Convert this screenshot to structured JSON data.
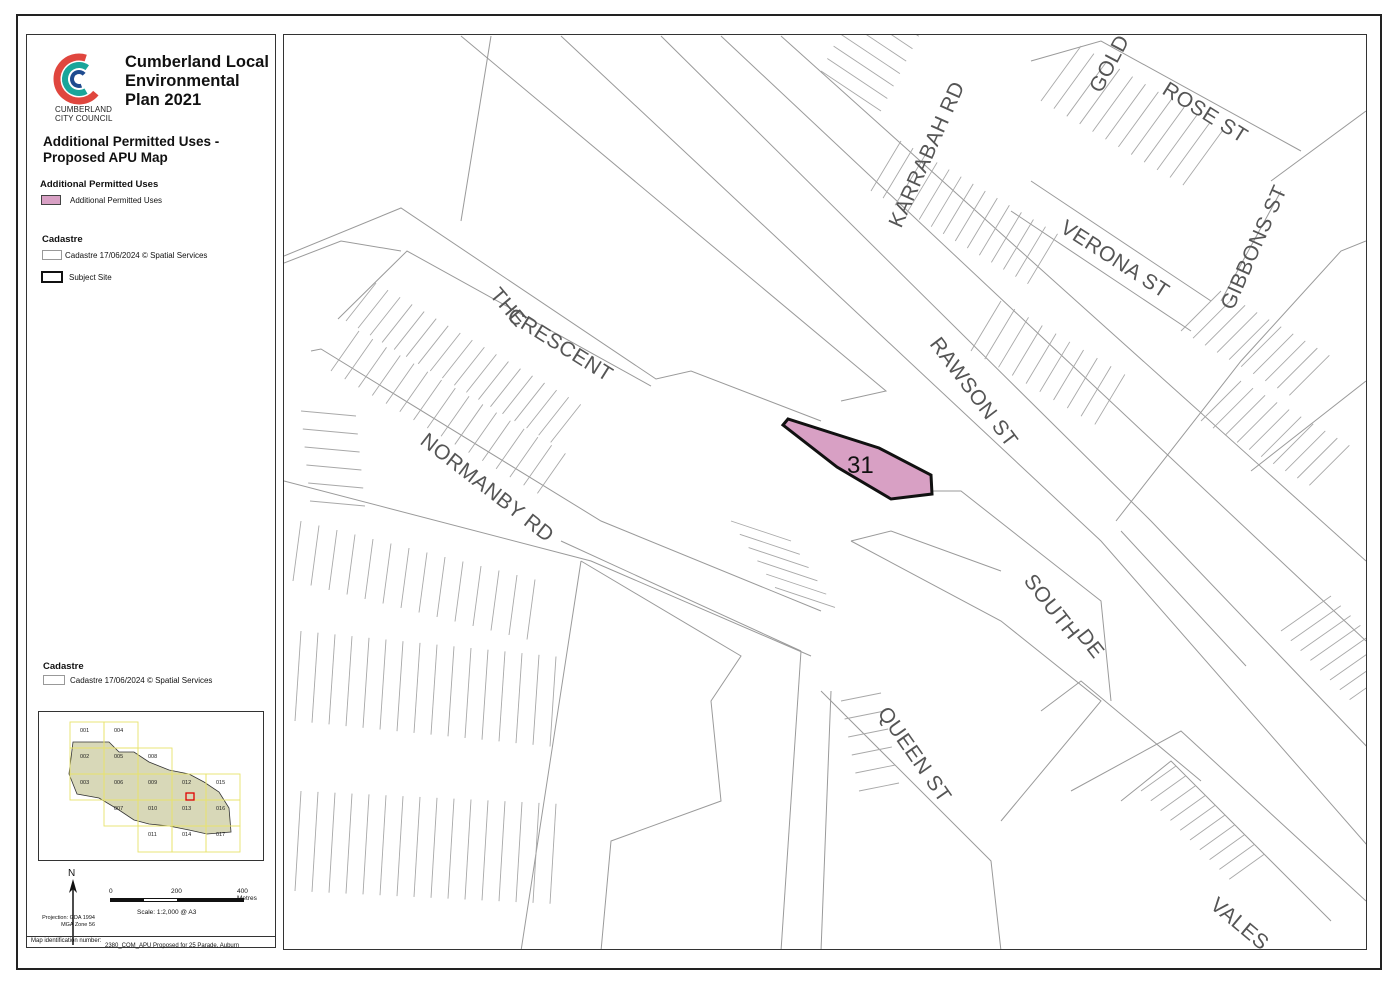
{
  "legend": {
    "council_logo_text": [
      "CUMBERLAND",
      "CITY COUNCIL"
    ],
    "plan_title": [
      "Cumberland Local",
      "Environmental",
      "Plan 2021"
    ],
    "map_title": [
      "Additional Permitted Uses -",
      "Proposed APU Map"
    ],
    "apu_heading": "Additional Permitted Uses",
    "apu_item": "Additional Permitted Uses",
    "cadastre_heading": "Cadastre",
    "cadastre_item": "Cadastre 17/06/2024 © Spatial Services",
    "subject_item": "Subject Site",
    "cadastre_heading_2": "Cadastre",
    "cadastre_item_2": "Cadastre 17/06/2024 © Spatial Services",
    "inset_tiles": [
      "001",
      "004",
      "002",
      "005",
      "008",
      "003",
      "006",
      "009",
      "012",
      "015",
      "007",
      "010",
      "013",
      "016",
      "011",
      "014",
      "017"
    ],
    "north_label": "N",
    "scale_ticks": [
      "0",
      "200",
      "400 Metres"
    ],
    "scale_text": "Scale: 1:2,000 @ A3",
    "projection": [
      "Projection: GDA 1994",
      "MGA Zone 56"
    ],
    "map_id_label": "Map identification number:",
    "map_id_value": "2380_COM_APU Proposed for 25 Parade, Auburn"
  },
  "colors": {
    "apu_fill": "#d8a0c4",
    "subject_outline": "#111111",
    "cadastre_line": "#9a9a9a",
    "inset_tile": "#e8e36a",
    "inset_lga": "#d8d8b8",
    "logo_red": "#e0463e",
    "logo_teal": "#1aa59a",
    "logo_blue": "#1e4b8f"
  },
  "map": {
    "site_label": "31",
    "streets": {
      "rose": "ROSE ST",
      "gold": "GOLD",
      "karrabah": "KARRABAH RD",
      "verona": "VERONA ST",
      "gibbons": "GIBBONS ST",
      "rawson": "RAWSON ST",
      "the_crescent_the": "THE",
      "the_crescent": "CRESCENT",
      "normanby": "NORMANBY RD",
      "south": "SOUTH",
      "south_de": "DE",
      "queen": "QUEEN ST",
      "vales": "VALES"
    }
  }
}
